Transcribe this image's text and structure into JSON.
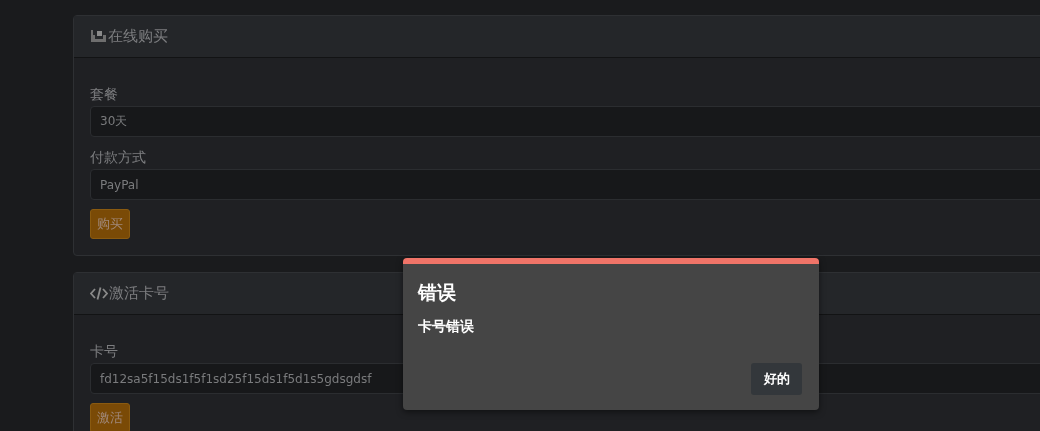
{
  "cards": [
    {
      "title": "在线购买",
      "fields": [
        {
          "label": "套餐",
          "value": "30天"
        },
        {
          "label": "付款方式",
          "value": "PayPal"
        }
      ],
      "button": "购买"
    },
    {
      "title": "激活卡号",
      "fields": [
        {
          "label": "卡号",
          "value": "fd12sa5f15ds1f5f1sd25f15ds1f5d1s5gdsgdsf"
        }
      ],
      "button": "激活"
    }
  ],
  "dialog": {
    "title": "错误",
    "message": "卡号错误",
    "button": "好的"
  }
}
